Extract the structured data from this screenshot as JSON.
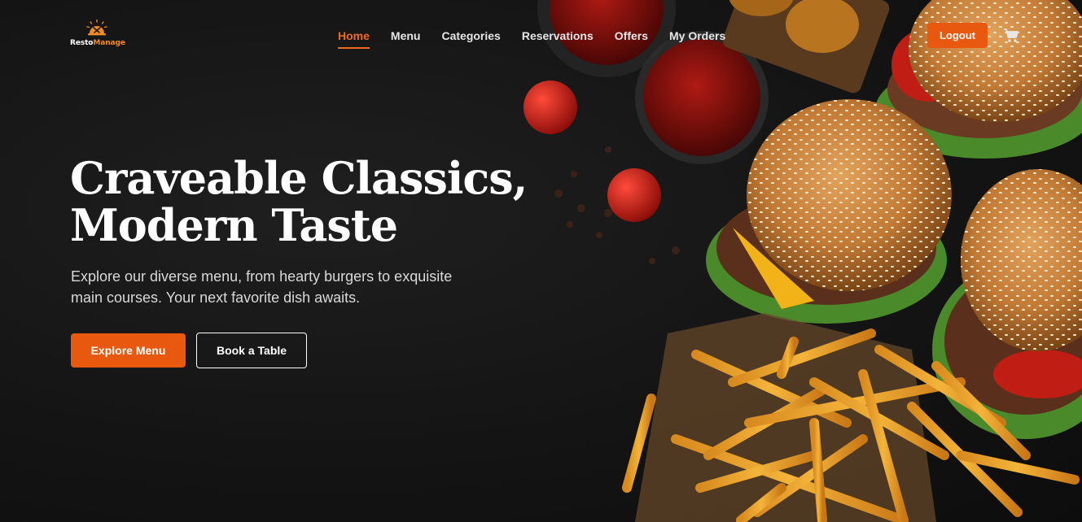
{
  "brand": {
    "name_part1": "Resto",
    "name_part2": "Manage",
    "icon": "chef-dish-icon"
  },
  "nav": {
    "items": [
      {
        "label": "Home",
        "active": true
      },
      {
        "label": "Menu",
        "active": false
      },
      {
        "label": "Categories",
        "active": false
      },
      {
        "label": "Reservations",
        "active": false
      },
      {
        "label": "Offers",
        "active": false
      },
      {
        "label": "My Orders",
        "active": false
      }
    ],
    "logout_label": "Logout",
    "cart_icon": "cart-icon"
  },
  "hero": {
    "title_line1": "Craveable Classics,",
    "title_line2": "Modern Taste",
    "subtitle_line1": "Explore our diverse menu, from hearty burgers to exquisite",
    "subtitle_line2": "main courses. Your next favorite dish awaits.",
    "primary_cta": "Explore Menu",
    "secondary_cta": "Book a Table"
  },
  "colors": {
    "accent": "#e9580f",
    "background": "#141414",
    "text": "#ffffff"
  }
}
